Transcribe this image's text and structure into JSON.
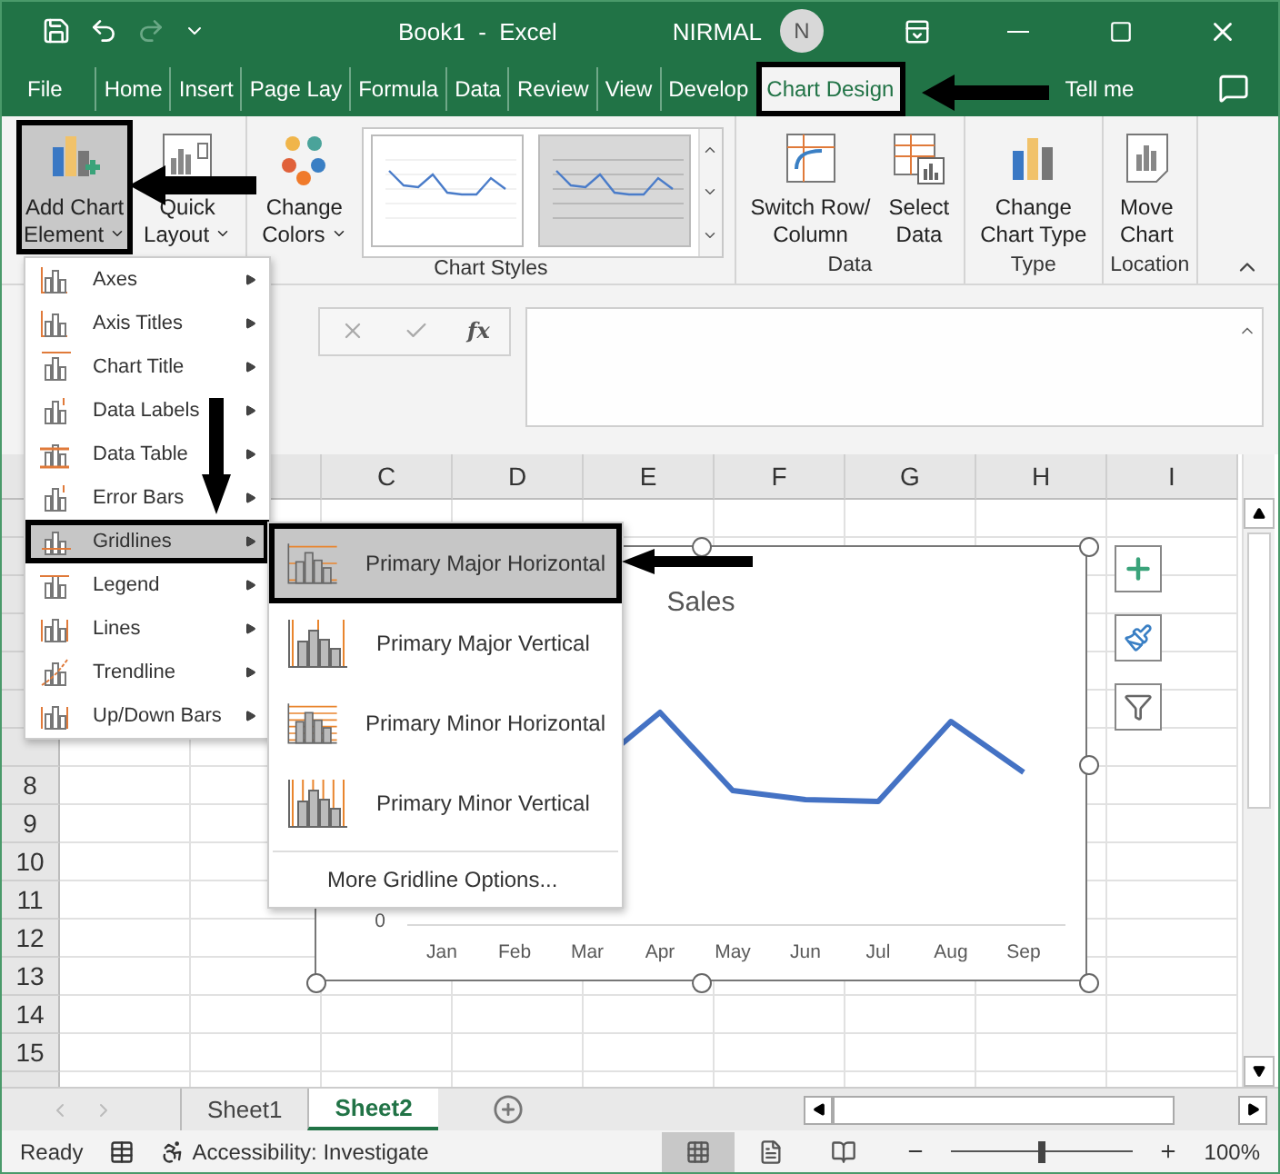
{
  "window": {
    "title": "Book1  -  Excel",
    "user": "NIRMAL",
    "avatar": "N"
  },
  "ribbon_tabs": [
    {
      "label": "File",
      "selected": false
    },
    {
      "label": "Home",
      "selected": false
    },
    {
      "label": "Insert",
      "selected": false
    },
    {
      "label": "Page Lay",
      "selected": false
    },
    {
      "label": "Formula",
      "selected": false
    },
    {
      "label": "Data",
      "selected": false
    },
    {
      "label": "Review",
      "selected": false
    },
    {
      "label": "View",
      "selected": false
    },
    {
      "label": "Develop",
      "selected": false
    },
    {
      "label": "Chart Design",
      "selected": true
    }
  ],
  "tell_me": "Tell me",
  "ribbon_groups": [
    {
      "commands": [
        {
          "lines": [
            "Add Chart",
            "Element"
          ],
          "dropdown": true,
          "selected": true
        },
        {
          "lines": [
            "Quick",
            "Layout"
          ],
          "dropdown": true,
          "selected": false
        }
      ]
    },
    {
      "label": "Chart Styles",
      "commands": [
        {
          "lines": [
            "Change",
            "Colors"
          ],
          "dropdown": true,
          "selected": false
        }
      ],
      "gallery": true
    },
    {
      "label": "Data",
      "commands": [
        {
          "lines": [
            "Switch Row/",
            "Column"
          ],
          "dropdown": false,
          "selected": false
        },
        {
          "lines": [
            "Select",
            "Data"
          ],
          "dropdown": false,
          "selected": false
        }
      ]
    },
    {
      "label": "Type",
      "commands": [
        {
          "lines": [
            "Change",
            "Chart Type"
          ],
          "dropdown": false,
          "selected": false
        }
      ]
    },
    {
      "label": "Location",
      "commands": [
        {
          "lines": [
            "Move",
            "Chart"
          ],
          "dropdown": false,
          "selected": false
        }
      ]
    }
  ],
  "formula_bar": {
    "fx": "fx"
  },
  "columns": [
    "C",
    "D",
    "E",
    "F",
    "G",
    "H",
    "I"
  ],
  "rows": [
    "8",
    "9",
    "10",
    "11",
    "12",
    "13",
    "14",
    "15"
  ],
  "chart": {
    "title": "Sales",
    "y_tick": "0",
    "x_labels": [
      "Jan",
      "Feb",
      "Mar",
      "Apr",
      "May",
      "Jun",
      "Jul",
      "Aug",
      "Sep"
    ]
  },
  "chart_menu": {
    "items": [
      {
        "label": "Axes",
        "selected": false
      },
      {
        "label": "Axis Titles",
        "selected": false
      },
      {
        "label": "Chart Title",
        "selected": false
      },
      {
        "label": "Data Labels",
        "selected": false
      },
      {
        "label": "Data Table",
        "selected": false
      },
      {
        "label": "Error Bars",
        "selected": false
      },
      {
        "label": "Gridlines",
        "selected": true
      },
      {
        "label": "Legend",
        "selected": false
      },
      {
        "label": "Lines",
        "selected": false
      },
      {
        "label": "Trendline",
        "selected": false
      },
      {
        "label": "Up/Down Bars",
        "selected": false
      }
    ]
  },
  "gridlines_submenu": {
    "items": [
      {
        "label": "Primary Major Horizontal",
        "selected": true
      },
      {
        "label": "Primary Major Vertical",
        "selected": false
      },
      {
        "label": "Primary Minor Horizontal",
        "selected": false
      },
      {
        "label": "Primary Minor Vertical",
        "selected": false
      }
    ],
    "more": "More Gridline Options..."
  },
  "sheet_tabs": [
    {
      "label": "Sheet1",
      "selected": false
    },
    {
      "label": "Sheet2",
      "selected": true
    }
  ],
  "status_bar": {
    "mode": "Ready",
    "accessibility": "Accessibility: Investigate",
    "views": [
      {
        "selected": true
      },
      {
        "selected": false
      },
      {
        "selected": false
      }
    ],
    "zoom": {
      "level": 0.5,
      "reading": "100%"
    }
  }
}
